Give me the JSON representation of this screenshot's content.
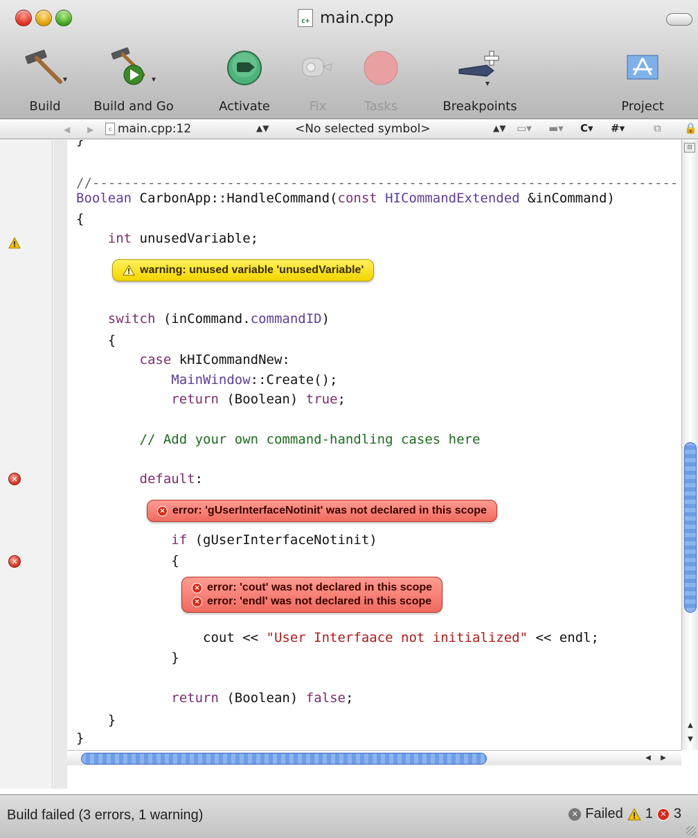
{
  "window": {
    "title": "main.cpp"
  },
  "toolbar": {
    "items": [
      {
        "label": "Build",
        "icon": "hammer-icon",
        "enabled": true
      },
      {
        "label": "Build and Go",
        "icon": "build-and-go-icon",
        "enabled": true
      },
      {
        "label": "Activate",
        "icon": "activate-icon",
        "enabled": true
      },
      {
        "label": "Fix",
        "icon": "fix-icon",
        "enabled": false
      },
      {
        "label": "Tasks",
        "icon": "tasks-stop-icon",
        "enabled": false
      },
      {
        "label": "Breakpoints",
        "icon": "breakpoints-icon",
        "enabled": true
      },
      {
        "label": "Project",
        "icon": "project-icon",
        "enabled": true
      }
    ]
  },
  "navbar": {
    "file_location": "main.cpp:12",
    "symbol": "<No selected symbol>",
    "c_button": "C",
    "hash_button": "#"
  },
  "editor": {
    "lines": {
      "brace_top": "}",
      "sep1": "//----------------------------------------------------------------------------",
      "sig_ret": "Boolean",
      "sig_name": " CarbonApp::HandleCommand(",
      "sig_const": "const",
      "sig_type": " HICommandExtended",
      "sig_param": " &inCommand)",
      "open1": "{",
      "int_kw": "    int",
      "int_var": " unusedVariable;",
      "switch_kw": "    switch",
      "switch_rest": " (inCommand.",
      "switch_member": "commandID",
      "switch_close": ")",
      "open2": "    {",
      "case_kw": "        case",
      "case_rest": " kHICommandNew:",
      "mw_cls": "            MainWindow",
      "mw_rest": "::Create();",
      "ret1_kw": "            return",
      "ret1_rest": " (Boolean) ",
      "ret1_val": "true",
      "ret1_end": ";",
      "comment": "        // Add your own command-handling cases here",
      "default_kw": "        default",
      "default_end": ":",
      "if_kw": "            if",
      "if_rest": " (gUserInterfaceNotinit)",
      "open3": "            {",
      "cout": "                cout << ",
      "cout_str": "\"User Interfaace not initialized\"",
      "cout_end": " << endl;",
      "close3": "            }",
      "ret2_kw": "            return",
      "ret2_rest": " (Boolean) ",
      "ret2_val": "false",
      "ret2_end": ";",
      "close2": "    }",
      "close1": "}",
      "sep2": "//----------------------------------------------------------------------------"
    },
    "warning": "warning: unused variable 'unusedVariable'",
    "errors": {
      "scope_error": "error: 'gUserInterfaceNotinit' was not declared in this scope",
      "cout_error": "error: 'cout' was not declared in this scope",
      "endl_error": "error: 'endl' was not declared in this scope"
    }
  },
  "status": {
    "message": "Build failed (3 errors, 1 warning)",
    "result": "Failed",
    "warning_count": "1",
    "error_count": "3"
  },
  "colors": {
    "keyword": "#7b2c6f",
    "comment": "#1e6b1e",
    "string": "#b01a1a",
    "warning_bubble": "#f4d400",
    "error_bubble": "#f06a5f"
  }
}
